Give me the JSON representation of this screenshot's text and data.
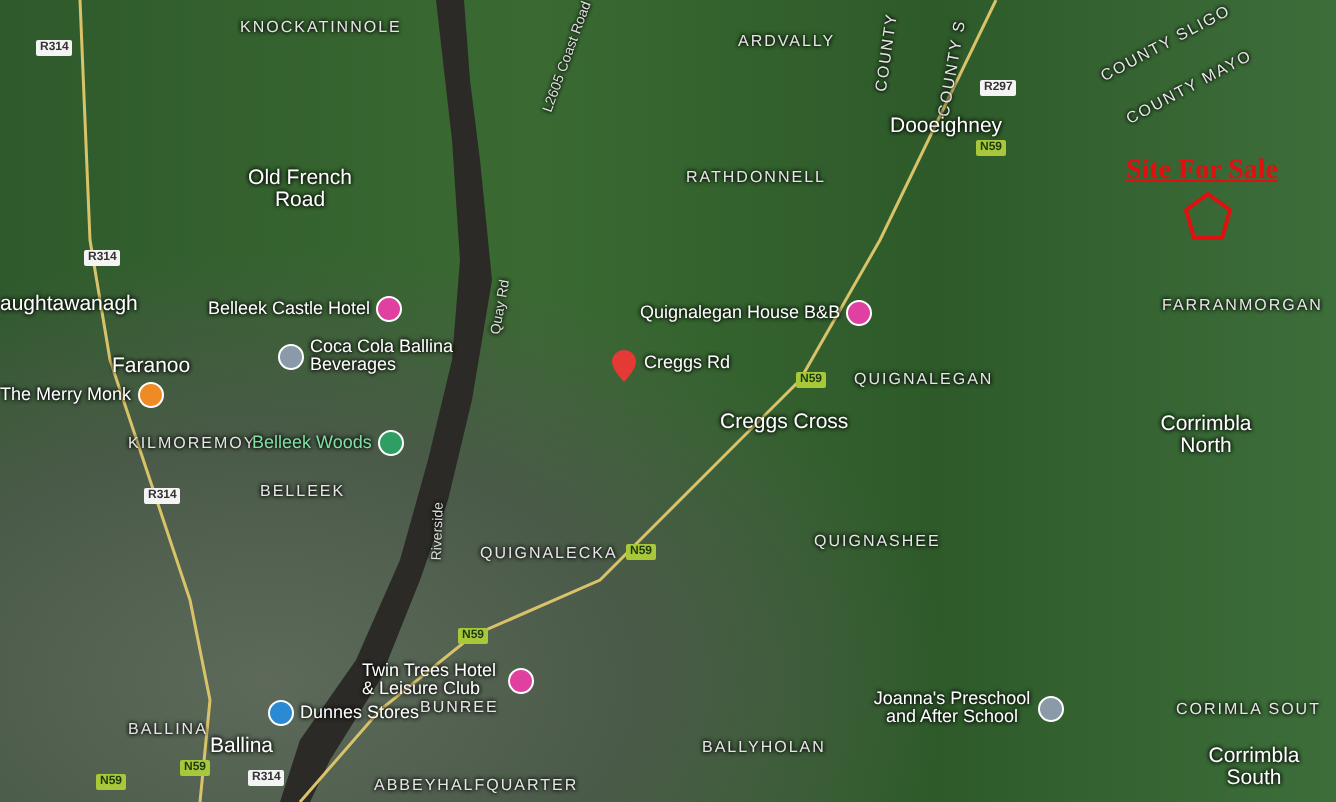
{
  "map": {
    "labels": [
      {
        "text": "KNOCKATINNOLE",
        "kind": "area"
      },
      {
        "text": "L2605 Coast Road",
        "kind": "road"
      },
      {
        "text": "ARDVALLY",
        "kind": "area"
      },
      {
        "text": "COUNTY",
        "kind": "boundary"
      },
      {
        "text": "COUNTY S",
        "kind": "boundary"
      },
      {
        "text": "COUNTY SLIGO",
        "kind": "boundary"
      },
      {
        "text": "COUNTY MAYO",
        "kind": "boundary"
      },
      {
        "text": "Dooeighney",
        "kind": "town"
      },
      {
        "text": "Old French Road",
        "kind": "town"
      },
      {
        "text": "RATHDONNELL",
        "kind": "area"
      },
      {
        "text": "aughtawanagh",
        "kind": "town"
      },
      {
        "text": "Quay Rd",
        "kind": "road"
      },
      {
        "text": "FARRANMORGAN",
        "kind": "area"
      },
      {
        "text": "Faranoo",
        "kind": "town"
      },
      {
        "text": "QUIGNALEGAN",
        "kind": "area"
      },
      {
        "text": "KILMOREMOY",
        "kind": "area"
      },
      {
        "text": "Creggs Cross",
        "kind": "town"
      },
      {
        "text": "Corrimbla North",
        "kind": "town"
      },
      {
        "text": "BELLEEK",
        "kind": "area"
      },
      {
        "text": "Riverside",
        "kind": "road"
      },
      {
        "text": "QUIGNALECKA",
        "kind": "area"
      },
      {
        "text": "QUIGNASHEE",
        "kind": "area"
      },
      {
        "text": "BUNREE",
        "kind": "area"
      },
      {
        "text": "CORIMLA SOUT",
        "kind": "area"
      },
      {
        "text": "BALLINA",
        "kind": "area"
      },
      {
        "text": "Ballina",
        "kind": "town"
      },
      {
        "text": "BALLYHOLAN",
        "kind": "area"
      },
      {
        "text": "Corrimbla South",
        "kind": "town"
      },
      {
        "text": "ABBEYHALFQUARTER",
        "kind": "area"
      }
    ],
    "places": [
      {
        "name": "Belleek Castle Hotel",
        "kind": "hotel",
        "color": "#e040a0"
      },
      {
        "name": "Quignalegan House B&B",
        "kind": "hotel",
        "color": "#e040a0"
      },
      {
        "name": "Coca Cola Ballina Beverages",
        "kind": "business",
        "color": "#8a9aa8"
      },
      {
        "name": "Creggs Rd",
        "kind": "location",
        "color": "#e53935"
      },
      {
        "name": "The Merry Monk",
        "kind": "restaurant",
        "color": "#f08a24"
      },
      {
        "name": "Belleek Woods",
        "kind": "park",
        "color": "#2e9e63"
      },
      {
        "name": "Twin Trees Hotel & Leisure Club",
        "kind": "hotel",
        "color": "#e040a0"
      },
      {
        "name": "Dunnes Stores",
        "kind": "shop",
        "color": "#2a8ad4"
      },
      {
        "name": "Joanna's Preschool and After School",
        "kind": "school",
        "color": "#8a9aa8"
      }
    ],
    "road_shields": [
      {
        "text": "R314",
        "kind": "regional"
      },
      {
        "text": "R314",
        "kind": "regional"
      },
      {
        "text": "R297",
        "kind": "regional"
      },
      {
        "text": "N59",
        "kind": "national"
      },
      {
        "text": "N59",
        "kind": "national"
      },
      {
        "text": "N59",
        "kind": "national"
      },
      {
        "text": "R314",
        "kind": "regional"
      },
      {
        "text": "N59",
        "kind": "national"
      },
      {
        "text": "N59",
        "kind": "national"
      },
      {
        "text": "N59",
        "kind": "national"
      },
      {
        "text": "R314",
        "kind": "regional"
      }
    ],
    "annotation": {
      "text": "Site For Sale"
    }
  }
}
